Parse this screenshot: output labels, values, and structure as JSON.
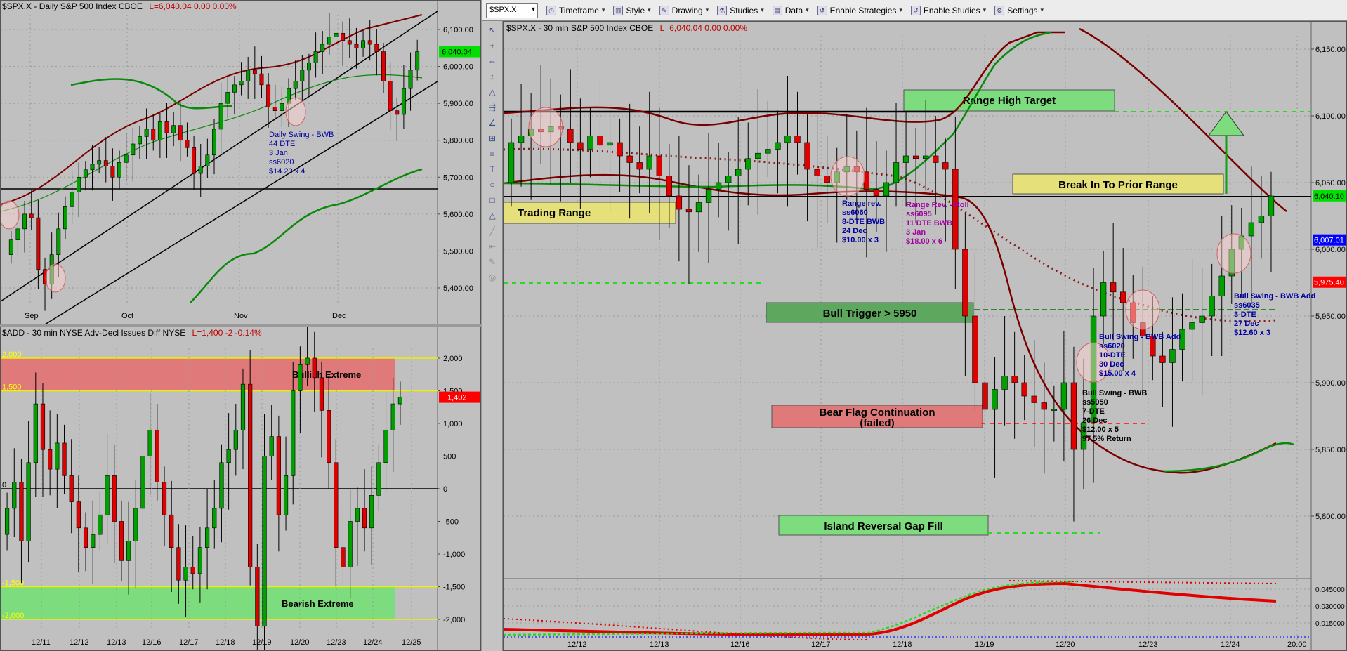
{
  "toolbar": {
    "symbol": "$SPX.X",
    "items": [
      "Timeframe",
      "Style",
      "Drawing",
      "Studies",
      "Data",
      "Enable Strategies",
      "Enable Studies",
      "Settings"
    ]
  },
  "tools": [
    "↖",
    "+",
    "⇔",
    "↕",
    "△",
    "⇶",
    "∠",
    "⊞",
    "≡",
    "T",
    "○",
    "□",
    "△",
    "╱",
    "⇤",
    "✎",
    "◎"
  ],
  "chart_data": [
    {
      "type": "line",
      "panel": "daily",
      "title": "$SPX.X - Daily  S&P 500 Index  CBOE",
      "quote": "L=6,040.04  0.00  0.00%",
      "price_tag": "6,040.04",
      "ylim": [
        5360,
        6140
      ],
      "y_ticks": [
        "6,100.00",
        "6,000.00",
        "5,900.00",
        "5,800.00",
        "5,700.00",
        "5,600.00",
        "5,500.00",
        "5,400.00"
      ],
      "y_tick_values": [
        6100,
        6000,
        5900,
        5800,
        5700,
        5600,
        5500,
        5400
      ],
      "x_labels": [
        "Sep",
        "Oct",
        "Nov",
        "Dec"
      ],
      "annotation": [
        "Daily Swing - BWB",
        "44 DTE",
        "3 Jan",
        "ss6020",
        "$14.20 x 4"
      ],
      "series": [
        {
          "name": "",
          "values": [
            5530,
            5560,
            5600,
            5590,
            5450,
            5410,
            5490,
            5560,
            5620,
            5660,
            5700,
            5720,
            5735,
            5745,
            5730,
            5700,
            5740,
            5760,
            5790,
            5810,
            5830,
            5800,
            5850,
            5820,
            5840,
            5800,
            5780,
            5710,
            5730,
            5760,
            5830,
            5900,
            5930,
            5950,
            5960,
            5990,
            5980,
            5950,
            5890,
            5880,
            5900,
            5940,
            5960,
            5990,
            6010,
            6040,
            6060,
            6080,
            6090,
            6070,
            6060,
            6050,
            6070,
            6060,
            6040,
            5960,
            5880,
            5870,
            5940,
            5990,
            6040
          ]
        }
      ]
    },
    {
      "type": "line",
      "panel": "add",
      "title": "$ADD - 30 min  NYSE Adv-Decl Issues Diff  NYSE",
      "quote": "L=1,400  -2  -0.14%",
      "price_tag": "1,402",
      "ylim": [
        -2150,
        2150
      ],
      "y_ticks": [
        "2,000",
        "1,500",
        "1,000",
        "500",
        "0",
        "-500",
        "-1,000",
        "-1,500",
        "-2,000"
      ],
      "y_tick_values": [
        2000,
        1500,
        1000,
        500,
        0,
        -500,
        -1000,
        -1500,
        -2000
      ],
      "left_labels": [
        "2,000",
        "1,500",
        "0",
        "-1,500",
        "-2,000"
      ],
      "left_label_values": [
        2000,
        1500,
        0,
        -1500,
        -2000
      ],
      "x_labels": [
        "12/11",
        "12/12",
        "12/13",
        "12/16",
        "12/17",
        "12/18",
        "12/19",
        "12/20",
        "12/23",
        "12/24",
        "12/25"
      ],
      "zones": [
        {
          "label": "Bullish Extreme",
          "from": 1500,
          "to": 2000
        },
        {
          "label": "Bearish Extreme",
          "from": -2000,
          "to": -1500
        }
      ],
      "series": [
        {
          "name": "",
          "values": [
            -300,
            100,
            -800,
            400,
            1300,
            600,
            300,
            700,
            200,
            -200,
            -600,
            -900,
            -700,
            -400,
            200,
            -500,
            -1100,
            -800,
            -300,
            500,
            900,
            100,
            -400,
            -900,
            -1400,
            -1200,
            -1300,
            -900,
            -600,
            -300,
            400,
            600,
            900,
            1600,
            -1200,
            -2100,
            500,
            800,
            -400,
            200,
            1500,
            1900,
            2000,
            1700,
            1200,
            400,
            -900,
            -1200,
            -500,
            -300,
            -600,
            -100,
            400,
            900,
            1300,
            1400
          ]
        }
      ]
    },
    {
      "type": "line",
      "panel": "spx30",
      "title": "$SPX.X - 30 min  S&P 500 Index  CBOE",
      "quote": "L=6,040.04  0.00  0.00%",
      "ylim": [
        5760,
        6160
      ],
      "y_ticks": [
        "6,150.00",
        "6,100.00",
        "6,050.00",
        "6,000.00",
        "5,950.00",
        "5,900.00",
        "5,850.00",
        "5,800.00"
      ],
      "y_tick_values": [
        6150,
        6100,
        6050,
        6000,
        5950,
        5900,
        5850,
        5800
      ],
      "price_tags": [
        {
          "label": "6,040.10",
          "value": 6040.1,
          "color": "#00e000"
        },
        {
          "label": "6,007.01",
          "value": 6007.01,
          "color": "#0000ff"
        },
        {
          "label": "5,975.40",
          "value": 5975.4,
          "color": "#ff0000"
        }
      ],
      "x_labels": [
        "12/12",
        "12/13",
        "12/16",
        "12/17",
        "12/18",
        "12/19",
        "12/20",
        "12/23",
        "12/24",
        "20:00"
      ],
      "boxes": [
        {
          "label": "Range High Target",
          "value": 6115,
          "color": "#7ddc7d"
        },
        {
          "label": "Break In To Prior Range",
          "value": 6042,
          "color": "#e6e07a"
        },
        {
          "label": "Trading Range",
          "value": 6020,
          "color": "#e6e07a"
        },
        {
          "label": "Bull Trigger > 5950",
          "value": 5948,
          "color": "#5ea75e"
        },
        {
          "label": "Bear Flag Continuation",
          "sub": "(failed)",
          "value": 5878,
          "color": "#e07a7a"
        },
        {
          "label": "Island Reversal Gap Fill",
          "value": 5787,
          "color": "#7ddc7d"
        }
      ],
      "annotations": [
        {
          "lines": [
            "Range rev.",
            "ss6060",
            "8-DTE BWB",
            "24 Dec",
            "$10.00 x 3"
          ],
          "color": "#0000a0"
        },
        {
          "lines": [
            "Range Rev. - Roll",
            "ss6095",
            "11 DTE BWB",
            "3 Jan",
            "$18.00 x 6"
          ],
          "color": "#a000a0"
        },
        {
          "lines": [
            "Bull Swing - BWB",
            "ss5950",
            "7-DTE",
            "26 Dec",
            "$12.00 x 5",
            "97.5% Return"
          ],
          "color": "#000000"
        },
        {
          "lines": [
            "Bull Swing - BWB Add",
            "ss6020",
            "10-DTE",
            "30 Dec",
            "$15.00 x 4"
          ],
          "color": "#0000a0"
        },
        {
          "lines": [
            "Bull Swing - BWB Add",
            "ss6035",
            "3-DTE",
            "27 Dec",
            "$12.60 x 3"
          ],
          "color": "#0000a0"
        }
      ],
      "sub_ticks": [
        "0.045000",
        "0.030000",
        "0.015000"
      ],
      "sub_tick_values": [
        0.045,
        0.03,
        0.015
      ],
      "series": [
        {
          "name": "",
          "values": [
            6080,
            6085,
            6090,
            6088,
            6092,
            6090,
            6080,
            6075,
            6085,
            6078,
            6080,
            6070,
            6065,
            6060,
            6070,
            6055,
            6040,
            6030,
            6028,
            6035,
            6045,
            6050,
            6055,
            6060,
            6068,
            6072,
            6075,
            6080,
            6085,
            6080,
            6060,
            6055,
            6050,
            6058,
            6062,
            6058,
            6045,
            6040,
            6050,
            6065,
            6070,
            6068,
            6070,
            6065,
            6060,
            6000,
            5950,
            5900,
            5880,
            5895,
            5905,
            5900,
            5890,
            5885,
            5880,
            5880,
            5900,
            5850,
            5870,
            5950,
            5975,
            5968,
            5960,
            5945,
            5935,
            5920,
            5915,
            5925,
            5940,
            5945,
            5950,
            5965,
            5980,
            6000,
            6010,
            6020,
            6025,
            6040
          ]
        }
      ]
    }
  ]
}
